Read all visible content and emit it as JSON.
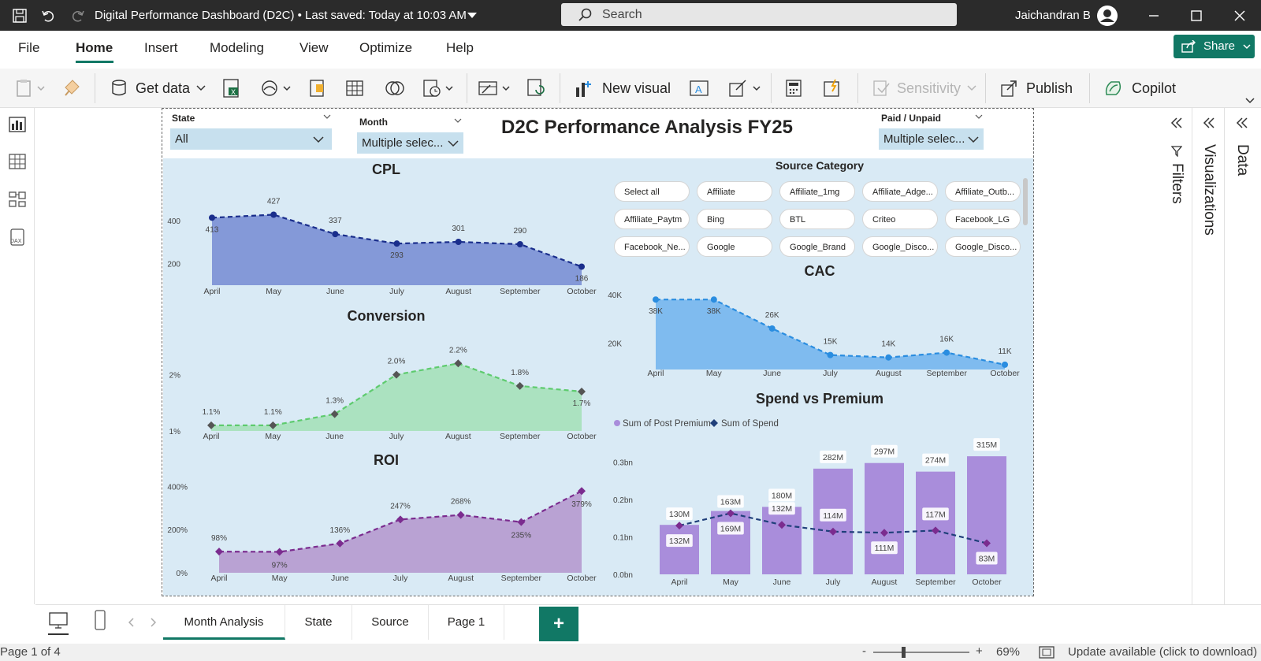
{
  "titlebar": {
    "doc_title": "Digital Performance Dashboard (D2C) • Last saved: Today at 10:03 AM",
    "search_placeholder": "Search",
    "user_name": "Jaichandran B"
  },
  "menu": {
    "items": [
      "File",
      "Home",
      "Insert",
      "Modeling",
      "View",
      "Optimize",
      "Help"
    ],
    "active": "Home",
    "share_label": "Share"
  },
  "ribbon": {
    "get_data": "Get data",
    "new_visual": "New visual",
    "sensitivity": "Sensitivity",
    "publish": "Publish",
    "copilot": "Copilot"
  },
  "right_panes": {
    "filters": "Filters",
    "visualizations": "Visualizations",
    "data": "Data"
  },
  "report": {
    "title": "D2C Performance Analysis FY25",
    "slicers": {
      "state": {
        "label": "State",
        "value": "All"
      },
      "month": {
        "label": "Month",
        "value": "Multiple selec..."
      },
      "paid": {
        "label": "Paid / Unpaid",
        "value": "Multiple selec..."
      }
    },
    "source_category": {
      "title": "Source Category",
      "items": [
        "Select all",
        "Affiliate",
        "Affiliate_1mg",
        "Affiliate_Adge...",
        "Affiliate_Outb...",
        "Affiliate_Paytm",
        "Bing",
        "BTL",
        "Criteo",
        "Facebook_LG",
        "Facebook_Ne...",
        "Google",
        "Google_Brand",
        "Google_Disco...",
        "Google_Disco..."
      ]
    }
  },
  "chart_data": [
    {
      "type": "area",
      "title": "CPL",
      "categories": [
        "April",
        "May",
        "June",
        "July",
        "August",
        "September",
        "October"
      ],
      "values": [
        413,
        427,
        337,
        293,
        301,
        290,
        186
      ],
      "labels": [
        "413",
        "427",
        "337",
        "293",
        "301",
        "290",
        "186"
      ],
      "yticks": [
        "200",
        "400"
      ],
      "ylim": [
        100,
        480
      ],
      "color": "#8095d6",
      "line_color": "#1a2e8c"
    },
    {
      "type": "area",
      "title": "Conversion",
      "categories": [
        "April",
        "May",
        "June",
        "July",
        "August",
        "September",
        "October"
      ],
      "values": [
        1.1,
        1.1,
        1.3,
        2.0,
        2.2,
        1.8,
        1.7
      ],
      "labels": [
        "1.1%",
        "1.1%",
        "1.3%",
        "2.0%",
        "2.2%",
        "1.8%",
        "1.7%"
      ],
      "yticks": [
        "1%",
        "2%"
      ],
      "ylim": [
        1.0,
        2.4
      ],
      "color": "#a9e2bd",
      "line_color": "#5ecb6e"
    },
    {
      "type": "area",
      "title": "ROI",
      "categories": [
        "April",
        "May",
        "June",
        "July",
        "August",
        "September",
        "October"
      ],
      "values": [
        98,
        97,
        136,
        247,
        268,
        235,
        379
      ],
      "labels": [
        "98%",
        "97%",
        "136%",
        "247%",
        "268%",
        "235%",
        "379%"
      ],
      "yticks": [
        "0%",
        "200%",
        "400%"
      ],
      "ylim": [
        0,
        420
      ],
      "color": "#b79ed1",
      "line_color": "#7b2c8f"
    },
    {
      "type": "area",
      "title": "CAC",
      "categories": [
        "April",
        "May",
        "June",
        "July",
        "August",
        "September",
        "October"
      ],
      "values": [
        38,
        38,
        26,
        15,
        14,
        16,
        11
      ],
      "labels": [
        "38K",
        "38K",
        "26K",
        "15K",
        "14K",
        "16K",
        "11K"
      ],
      "yticks": [
        "20K",
        "40K"
      ],
      "ylim": [
        9,
        41
      ],
      "color": "#7ab8ee",
      "line_color": "#2a8de0"
    },
    {
      "type": "bar",
      "title": "Spend vs Premium",
      "categories": [
        "April",
        "May",
        "June",
        "July",
        "August",
        "September",
        "October"
      ],
      "series": [
        {
          "name": "Sum of Post Premium",
          "values": [
            132,
            169,
            180,
            282,
            297,
            274,
            315
          ],
          "labels": [
            "132M",
            "169M",
            "180M",
            "282M",
            "297M",
            "274M",
            "315M"
          ],
          "color": "#a98ddb"
        },
        {
          "name": "Sum of Spend",
          "values": [
            130,
            163,
            132,
            114,
            111,
            117,
            83
          ],
          "labels": [
            "130M",
            "163M",
            "132M",
            "114M",
            "111M",
            "117M",
            "83M"
          ],
          "color": "#1f3f7a"
        }
      ],
      "yticks": [
        "0.0bn",
        "0.1bn",
        "0.2bn",
        "0.3bn"
      ],
      "ylim": [
        0,
        330
      ]
    }
  ],
  "tabs": [
    "Month Analysis",
    "State",
    "Source",
    "Page 1"
  ],
  "active_tab": "Month Analysis",
  "status": {
    "page": "Page 1 of 4",
    "zoom": "69%",
    "update": "Update available (click to download)"
  }
}
